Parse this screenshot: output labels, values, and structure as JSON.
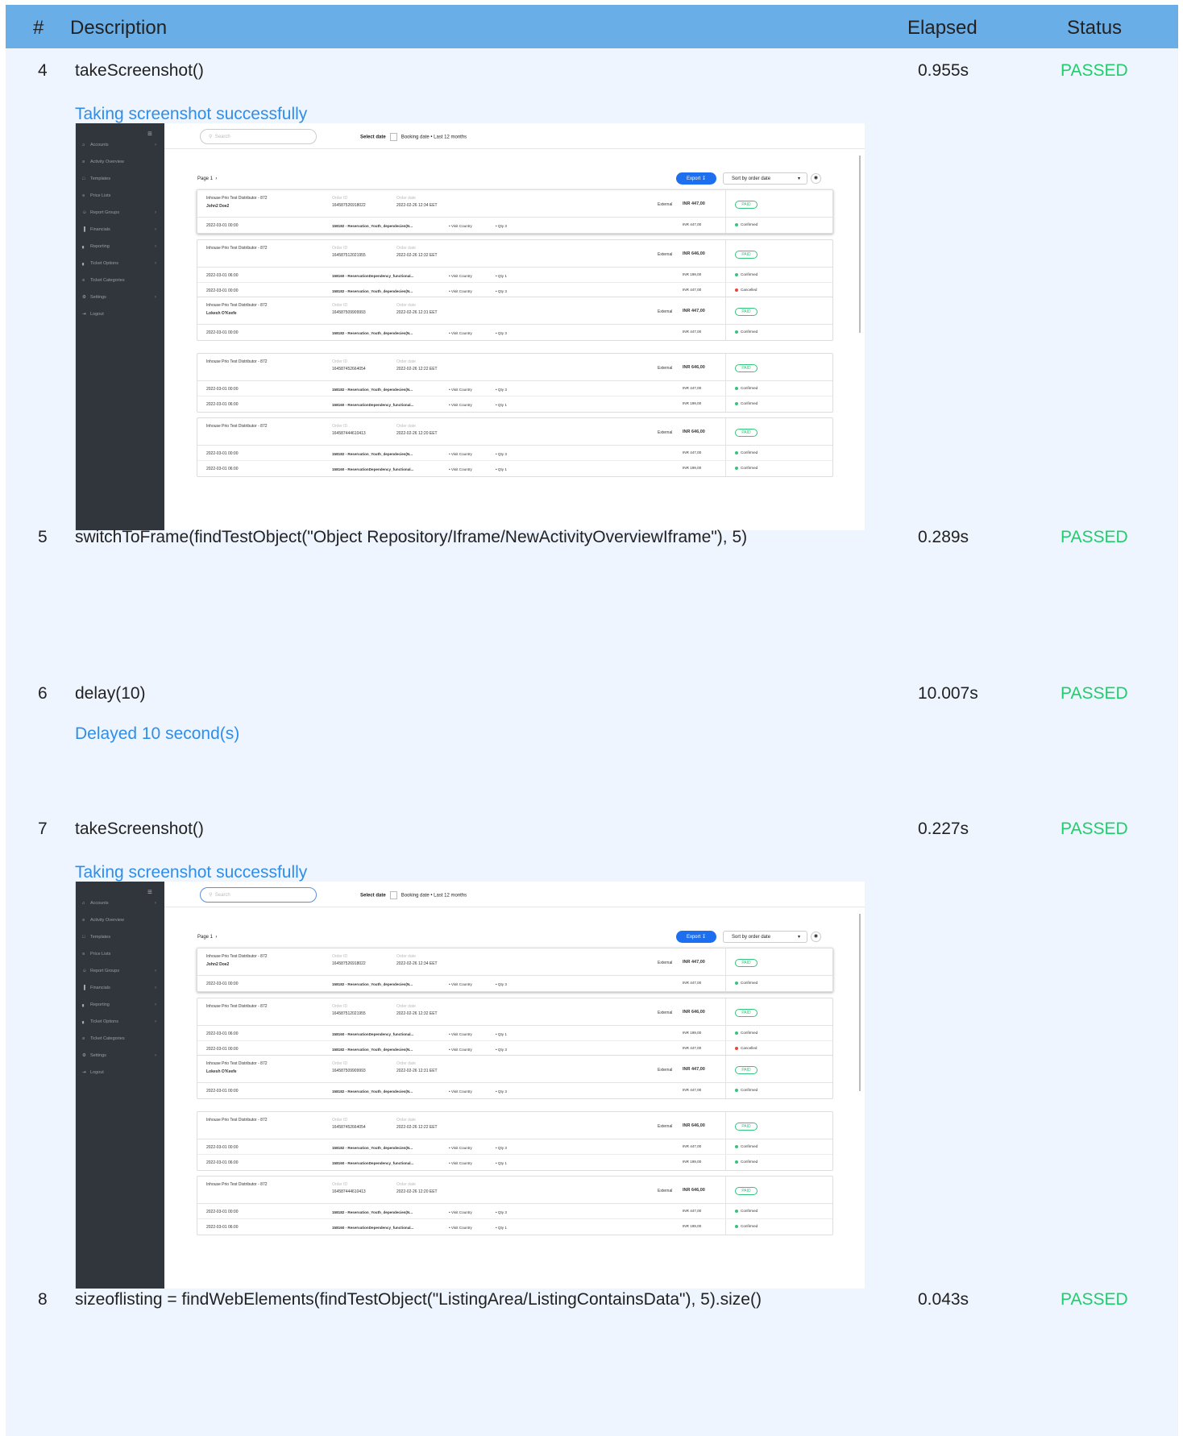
{
  "header": {
    "num": "#",
    "description": "Description",
    "elapsed": "Elapsed",
    "status": "Status"
  },
  "steps": [
    {
      "num": "4",
      "description": "takeScreenshot()",
      "elapsed": "0.955s",
      "status": "PASSED",
      "message": "Taking screenshot successfully"
    },
    {
      "num": "5",
      "description": "switchToFrame(findTestObject(\"Object Repository/Iframe/NewActivityOverviewIframe\"), 5)",
      "elapsed": "0.289s",
      "status": "PASSED"
    },
    {
      "num": "6",
      "description": "delay(10)",
      "elapsed": "10.007s",
      "status": "PASSED",
      "message": "Delayed 10 second(s)"
    },
    {
      "num": "7",
      "description": "takeScreenshot()",
      "elapsed": "0.227s",
      "status": "PASSED",
      "message": "Taking screenshot successfully"
    },
    {
      "num": "8",
      "description": "sizeoflisting = findWebElements(findTestObject(\"ListingArea/ListingContainsData\"), 5).size()",
      "elapsed": "0.043s",
      "status": "PASSED"
    }
  ],
  "app": {
    "menu": [
      "Accounts",
      "Activity Overview",
      "Templates",
      "Price Lists",
      "Report Groups",
      "Financials",
      "Reporting",
      "Ticket Options",
      "Ticket Categories",
      "Settings",
      "Logout"
    ],
    "menu_icons": [
      "home-icon",
      "list-icon",
      "template-icon",
      "list-icon",
      "users-icon",
      "bars-icon",
      "chart-icon",
      "chart-icon",
      "list-icon",
      "gear-icon",
      "logout-icon"
    ],
    "search_placeholder": "Search",
    "select_date": "Select date",
    "booking_date": "Booking date",
    "last_12": "Last 12 months",
    "page": "Page 1",
    "export": "Export",
    "sort": "Sort by order date",
    "order_id_label": "Order ID",
    "order_date_label": "Order date",
    "external": "External",
    "paid": "PAID",
    "colors": {
      "confirmed": "#35c47c",
      "cancelled": "#e8453c",
      "accent": "#1e6ff0"
    },
    "orders": [
      {
        "distributor": "Inhouse Prio Test Distributor - 872",
        "customer": "John2 Doe2",
        "order_id": "164587526918022",
        "order_date": "2022-02-26 12:34 EET",
        "total": "INR 447,00",
        "lines": [
          {
            "date": "2022-03-01 00:00",
            "product": "158182 - Reservation_Youth_dependecies(N...",
            "visit": "Visit Country",
            "qty": "Qty 3",
            "price": "INR 447,00",
            "status": "Confirmed",
            "state": "confirmed"
          }
        ]
      },
      {
        "distributor": "Inhouse Prio Test Distributor - 872",
        "customer": "",
        "order_id": "164587512021955",
        "order_date": "2022-02-26 12:32 EET",
        "total": "INR 646,00",
        "lines": [
          {
            "date": "2022-03-01 06:00",
            "product": "158160 - ReservationDependency_functional...",
            "visit": "Visit Country",
            "qty": "Qty 1",
            "price": "INR 199,00",
            "status": "Confirmed",
            "state": "confirmed"
          },
          {
            "date": "2022-03-01 00:00",
            "product": "158182 - Reservation_Youth_dependecies(N...",
            "visit": "Visit Country",
            "qty": "Qty 3",
            "price": "INR 447,00",
            "status": "Cancelled",
            "state": "cancelled"
          }
        ]
      },
      {
        "distributor": "Inhouse Prio Test Distributor - 872",
        "customer": "Lokesh O'Keefe",
        "order_id": "164587509909993",
        "order_date": "2022-02-26 12:31 EET",
        "total": "INR 447,00",
        "lines": [
          {
            "date": "2022-03-01 00:00",
            "product": "158182 - Reservation_Youth_dependecies(N...",
            "visit": "Visit Country",
            "qty": "Qty 3",
            "price": "INR 447,00",
            "status": "Confirmed",
            "state": "confirmed"
          }
        ]
      },
      {
        "distributor": "Inhouse Prio Test Distributor - 872",
        "customer": "",
        "order_id": "164587452664054",
        "order_date": "2022-02-26 12:22 EET",
        "total": "INR 646,00",
        "lines": [
          {
            "date": "2022-03-01 00:00",
            "product": "158182 - Reservation_Youth_dependecies(N...",
            "visit": "Visit Country",
            "qty": "Qty 3",
            "price": "INR 447,00",
            "status": "Confirmed",
            "state": "confirmed"
          },
          {
            "date": "2022-03-01 06:00",
            "product": "158160 - ReservationDependency_functional...",
            "visit": "Visit Country",
            "qty": "Qty 1",
            "price": "INR 199,00",
            "status": "Confirmed",
            "state": "confirmed"
          }
        ]
      },
      {
        "distributor": "Inhouse Prio Test Distributor - 872",
        "customer": "",
        "order_id": "164587444610413",
        "order_date": "2022-02-26 12:20 EET",
        "total": "INR 646,00",
        "lines": [
          {
            "date": "2022-03-01 00:00",
            "product": "158182 - Reservation_Youth_dependecies(N...",
            "visit": "Visit Country",
            "qty": "Qty 3",
            "price": "INR 447,00",
            "status": "Confirmed",
            "state": "confirmed"
          },
          {
            "date": "2022-03-01 06:00",
            "product": "158160 - ReservationDependency_functional...",
            "visit": "Visit Country",
            "qty": "Qty 1",
            "price": "INR 199,00",
            "status": "Confirmed",
            "state": "confirmed"
          }
        ]
      }
    ]
  }
}
